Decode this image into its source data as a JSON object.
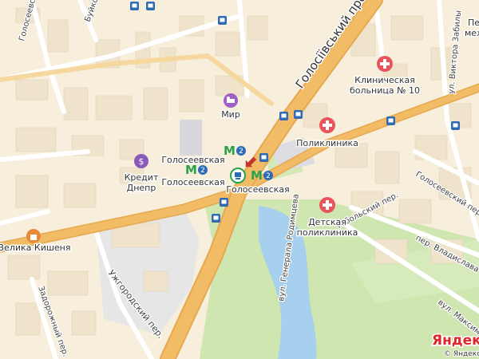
{
  "labels": {
    "metro_top": "Голосеевская",
    "metro_left": "Голосеевская",
    "metro_center": "Голосеевская",
    "mir": "Мир",
    "kredit_1": "Кредит",
    "kredit_2": "Днепр",
    "velyka_kyshenia": "Велика Кишеня",
    "polyclinic": "Поликлиника",
    "clinical_1": "Клиническая",
    "clinical_2": "больница № 10",
    "children_1": "Детская",
    "children_2": "поликлиника",
    "top_right_1": "Печ",
    "top_right_2": "меж"
  },
  "streets": {
    "holosiivskyi": "Голосіївський просп.",
    "uzhgorodskyi": "Ужгородский пер.",
    "tobolskyi": "Тобольский пер.",
    "holosiivskyi_per": "Голосеевский пер.",
    "vladyslava": "пер. Владислава Заречного",
    "rodymtseva": "вул. Генерала Родимцева",
    "zadorozhnyi": "Задорожный пер.",
    "zabily": "ул. Виктора Забилы",
    "holosiivska_side": "Голосеевская ул.",
    "buiko": "Буйко",
    "maksym": "вул. Максим"
  },
  "metro_line_number": "2",
  "brand": {
    "logo": "Яндекс",
    "copyright": "© Яндекс"
  },
  "colors": {
    "background": "#f7efdc",
    "building": "#efe3cc",
    "park": "#cfe6b0",
    "water": "#a6d0ee",
    "major_road": "#f2bb66",
    "road": "#ffffff",
    "metro": "#2aa24a",
    "bus_stop": "#2f6bb3",
    "hospital": "#e8555b",
    "hotel": "#a05ec7",
    "bank": "#8a5ab8",
    "shop": "#e88a3a"
  },
  "icons": [
    "metro-icon",
    "bus-stop-icon",
    "hospital-icon",
    "hotel-icon",
    "bank-icon",
    "shop-icon",
    "entrance-arrow-icon"
  ]
}
